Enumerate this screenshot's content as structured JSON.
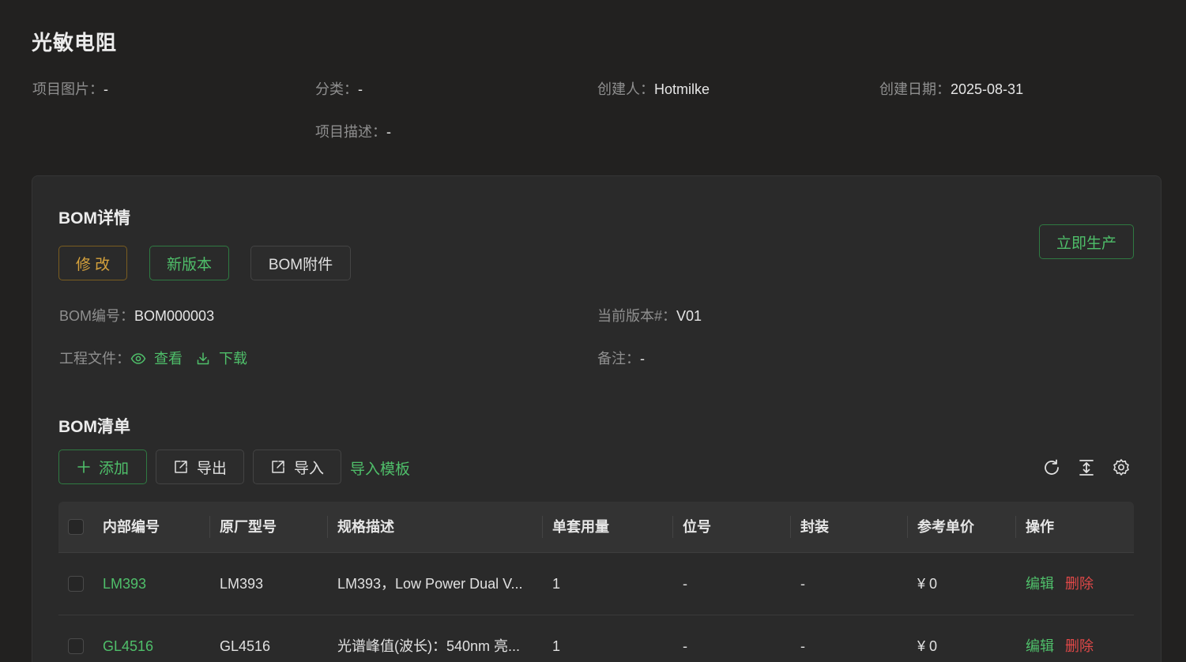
{
  "project": {
    "title": "光敏电阻",
    "image_label": "项目图片：",
    "image_value": "-",
    "category_label": "分类：",
    "category_value": "-",
    "creator_label": "创建人：",
    "creator_value": "Hotmilke",
    "created_date_label": "创建日期：",
    "created_date_value": "2025-08-31",
    "description_label": "项目描述：",
    "description_value": "-"
  },
  "bom_detail": {
    "title": "BOM详情",
    "edit_label": "修 改",
    "new_version_label": "新版本",
    "attachment_label": "BOM附件",
    "produce_label": "立即生产",
    "bom_no_label": "BOM编号：",
    "bom_no_value": "BOM000003",
    "version_label": "当前版本#：",
    "version_value": "V01",
    "project_file_label": "工程文件：",
    "view_label": "查看",
    "download_label": "下载",
    "remark_label": "备注：",
    "remark_value": "-"
  },
  "bom_list": {
    "title": "BOM清单",
    "add_label": "添加",
    "export_label": "导出",
    "import_label": "导入",
    "template_label": "导入模板",
    "columns": [
      "内部编号",
      "原厂型号",
      "规格描述",
      "单套用量",
      "位号",
      "封装",
      "参考单价",
      "操作"
    ],
    "rows": [
      {
        "internal_no": "LM393",
        "model": "LM393",
        "spec": "LM393，Low Power Dual V...",
        "qty": "1",
        "ref": "-",
        "package": "-",
        "price": "¥ 0",
        "edit": "编辑",
        "delete": "删除"
      },
      {
        "internal_no": "GL4516",
        "model": "GL4516",
        "spec": "光谱峰值(波长)：540nm 亮...",
        "qty": "1",
        "ref": "-",
        "package": "-",
        "price": "¥ 0",
        "edit": "编辑",
        "delete": "删除"
      }
    ]
  },
  "colors": {
    "background": "#222120",
    "card": "#2a2a2a",
    "accent_green": "#4fbf6a",
    "warning": "#d6a23c",
    "danger": "#e04848"
  }
}
